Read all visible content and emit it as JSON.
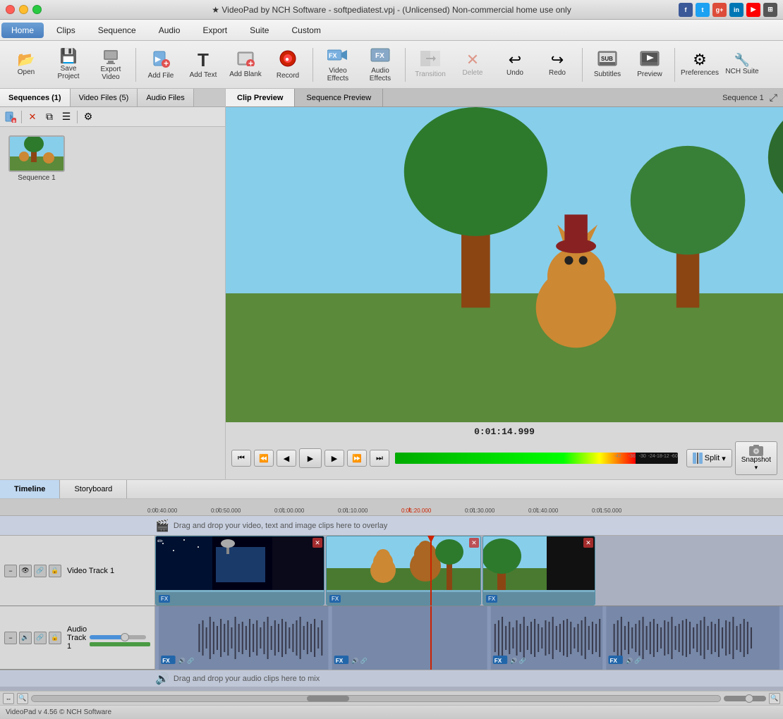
{
  "window": {
    "title": "★ VideoPad by NCH Software - softpediatest.vpj - (Unlicensed) Non-commercial home use only"
  },
  "menu": {
    "items": [
      {
        "id": "home",
        "label": "Home",
        "active": true
      },
      {
        "id": "clips",
        "label": "Clips",
        "active": false
      },
      {
        "id": "sequence",
        "label": "Sequence",
        "active": false
      },
      {
        "id": "audio",
        "label": "Audio",
        "active": false
      },
      {
        "id": "export",
        "label": "Export",
        "active": false
      },
      {
        "id": "suite",
        "label": "Suite",
        "active": false
      },
      {
        "id": "custom",
        "label": "Custom",
        "active": false
      }
    ]
  },
  "toolbar": {
    "buttons": [
      {
        "id": "open",
        "label": "Open",
        "icon": "📂"
      },
      {
        "id": "save-project",
        "label": "Save Project",
        "icon": "💾"
      },
      {
        "id": "export-video",
        "label": "Export Video",
        "icon": "📤"
      },
      {
        "id": "add-file",
        "label": "Add File",
        "icon": "➕"
      },
      {
        "id": "add-text",
        "label": "Add Text",
        "icon": "T"
      },
      {
        "id": "add-blank",
        "label": "Add Blank",
        "icon": "□"
      },
      {
        "id": "record",
        "label": "Record",
        "icon": "⏺"
      },
      {
        "id": "video-effects",
        "label": "Video Effects",
        "icon": "FX"
      },
      {
        "id": "audio-effects",
        "label": "Audio Effects",
        "icon": "FX"
      },
      {
        "id": "transition",
        "label": "Transition",
        "icon": "✂"
      },
      {
        "id": "delete",
        "label": "Delete",
        "icon": "✕"
      },
      {
        "id": "undo",
        "label": "Undo",
        "icon": "↩"
      },
      {
        "id": "redo",
        "label": "Redo",
        "icon": "↪"
      },
      {
        "id": "subtitles",
        "label": "Subtitles",
        "icon": "SUB"
      },
      {
        "id": "preview",
        "label": "Preview",
        "icon": "▶"
      },
      {
        "id": "preferences",
        "label": "Preferences",
        "icon": "⚙"
      },
      {
        "id": "nch-suite",
        "label": "NCH Suite",
        "icon": "★"
      }
    ]
  },
  "left_panel": {
    "tabs": [
      {
        "id": "sequences",
        "label": "Sequences (1)",
        "active": true
      },
      {
        "id": "video-files",
        "label": "Video Files (5)",
        "active": false
      },
      {
        "id": "audio-files",
        "label": "Audio Files",
        "active": false
      }
    ],
    "clips": [
      {
        "id": "seq1",
        "label": "Sequence 1"
      }
    ]
  },
  "preview": {
    "tabs": [
      {
        "id": "clip-preview",
        "label": "Clip Preview",
        "active": true
      },
      {
        "id": "sequence-preview",
        "label": "Sequence Preview",
        "active": false
      }
    ],
    "sequence_label": "Sequence 1",
    "time": "0:01:14.999",
    "controls": {
      "skip_start": "⏮",
      "step_back": "⏭",
      "rewind": "◀◀",
      "play": "▶",
      "forward": "▶▶",
      "step_fwd": "⏭",
      "skip_end": "⏭"
    },
    "split_label": "Split",
    "snapshot_label": "Snapshot"
  },
  "timeline": {
    "tabs": [
      {
        "id": "timeline",
        "label": "Timeline",
        "active": true
      },
      {
        "id": "storyboard",
        "label": "Storyboard",
        "active": false
      }
    ],
    "ruler_marks": [
      "0:00:40.000",
      "0:00:50.000",
      "0:01:00.000",
      "0:01:10.000",
      "0:01:20.000",
      "0:01:30.000",
      "0:01:40.000",
      "0:01:50.000"
    ],
    "overlay_text": "Drag and drop your video, text and image clips here to overlay",
    "audio_drop_text": "Drag and drop your audio clips here to mix",
    "video_track_label": "Video Track 1",
    "audio_track_label": "Audio Track 1"
  },
  "statusbar": {
    "text": "VideoPad v 4.56 © NCH Software"
  },
  "colors": {
    "accent_blue": "#4a7fbf",
    "playhead_red": "#cc2200",
    "track_bg": "#7ab0c8",
    "audio_bg": "#8898b8"
  }
}
